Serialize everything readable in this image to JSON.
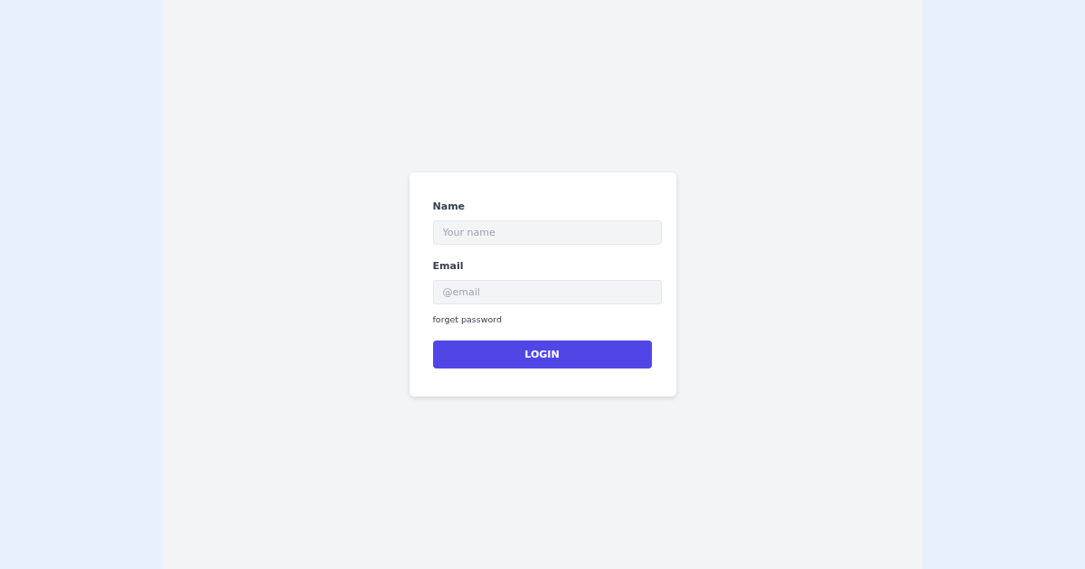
{
  "form": {
    "fields": [
      {
        "label": "Name",
        "placeholder": "Your name"
      },
      {
        "label": "Email",
        "placeholder": "@email"
      }
    ],
    "link": "forget password",
    "button": "LOGIN"
  }
}
